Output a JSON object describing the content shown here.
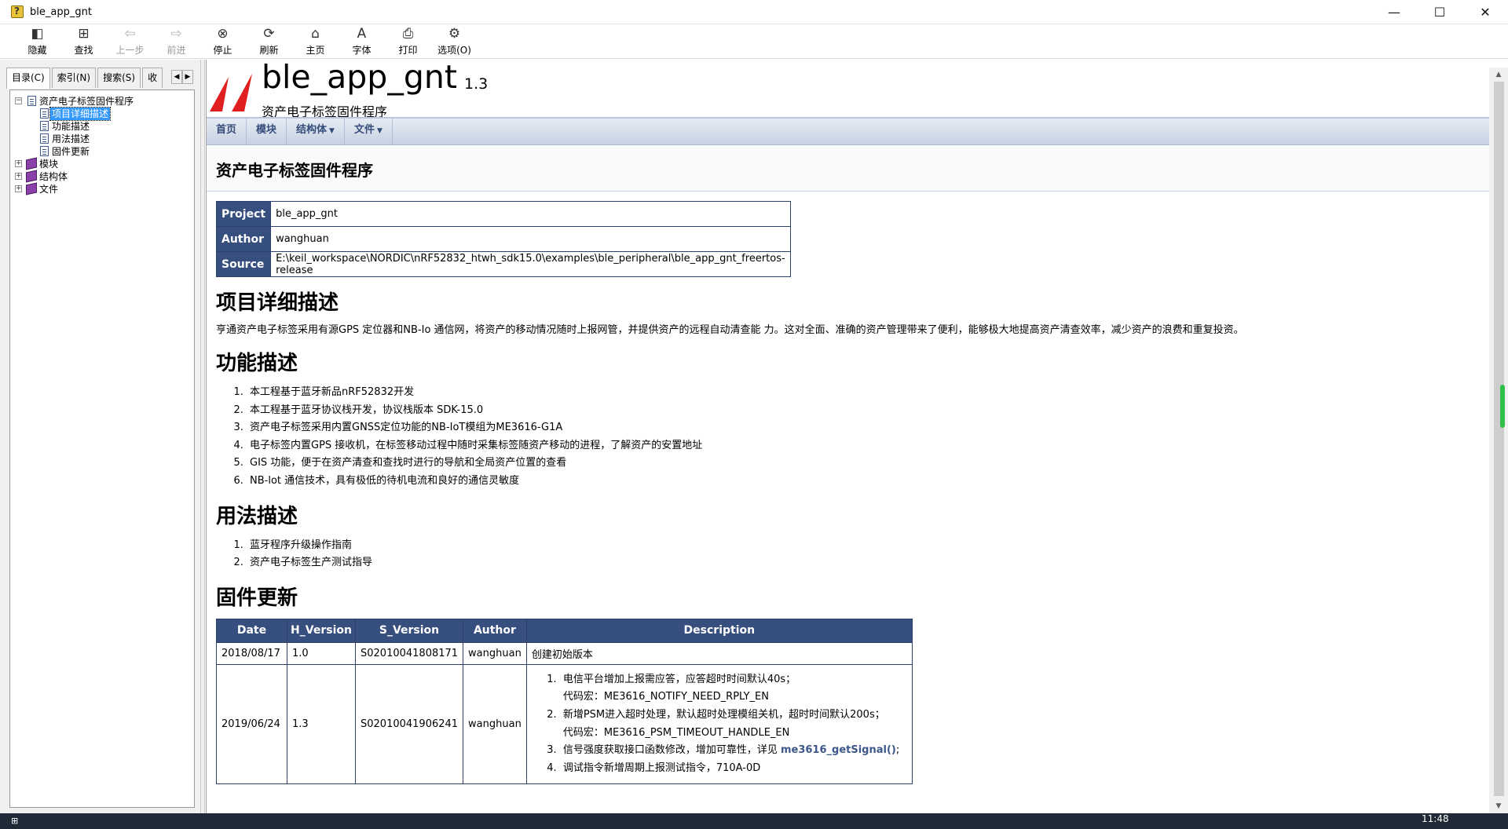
{
  "window": {
    "title": "ble_app_gnt",
    "controls": [
      "—",
      "☐",
      "✕"
    ]
  },
  "toolbar": {
    "buttons": [
      {
        "label": "隐藏",
        "icon": "hide-icon",
        "glyph": "◧",
        "enabled": true
      },
      {
        "label": "查找",
        "icon": "locate-icon",
        "glyph": "⊞",
        "enabled": true
      },
      {
        "label": "上一步",
        "icon": "back-arrow-icon",
        "glyph": "⇦",
        "enabled": false
      },
      {
        "label": "前进",
        "icon": "forward-arrow-icon",
        "glyph": "⇨",
        "enabled": false
      },
      {
        "label": "停止",
        "icon": "stop-icon",
        "glyph": "⊗",
        "enabled": true
      },
      {
        "label": "刷新",
        "icon": "refresh-icon",
        "glyph": "⟳",
        "enabled": true
      },
      {
        "label": "主页",
        "icon": "home-icon",
        "glyph": "⌂",
        "enabled": true
      },
      {
        "label": "字体",
        "icon": "font-icon",
        "glyph": "A",
        "enabled": true
      },
      {
        "label": "打印",
        "icon": "print-icon",
        "glyph": "⎙",
        "enabled": true
      },
      {
        "label": "选项(O)",
        "icon": "options-icon",
        "glyph": "⚙",
        "enabled": true
      }
    ]
  },
  "left_tabs": [
    "目录(C)",
    "索引(N)",
    "搜索(S)",
    "收"
  ],
  "tree": {
    "root": "资产电子标签固件程序",
    "children": [
      "项目详细描述",
      "功能描述",
      "用法描述",
      "固件更新"
    ],
    "books": [
      "模块",
      "结构体",
      "文件"
    ],
    "selected": "项目详细描述"
  },
  "header": {
    "project_name": "ble_app_gnt",
    "project_number": "1.3",
    "project_brief": "资产电子标签固件程序"
  },
  "navbar": [
    {
      "label": "首页",
      "dropdown": false
    },
    {
      "label": "模块",
      "dropdown": false
    },
    {
      "label": "结构体",
      "dropdown": true
    },
    {
      "label": "文件",
      "dropdown": true
    }
  ],
  "page_title": "资产电子标签固件程序",
  "info_table": [
    {
      "key": "Project",
      "value": "ble_app_gnt"
    },
    {
      "key": "Author",
      "value": "wanghuan"
    },
    {
      "key": "Source",
      "value": "E:\\keil_workspace\\NORDIC\\nRF52832_htwh_sdk15.0\\examples\\ble_peripheral\\ble_app_gnt_freertos-release"
    }
  ],
  "sections": {
    "detail_title": "项目详细描述",
    "detail_text": "亨通资产电子标签采用有源GPS 定位器和NB-Io 通信网，将资产的移动情况随时上报网管，并提供资产的远程自动清查能 力。这对全面、准确的资产管理带来了便利，能够极大地提高资产清查效率，减少资产的浪费和重复投资。",
    "function_title": "功能描述",
    "function_items": [
      "本工程基于蓝牙新品nRF52832开发",
      "本工程基于蓝牙协议栈开发，协议栈版本 SDK-15.0",
      "资产电子标签采用内置GNSS定位功能的NB-IoT模组为ME3616-G1A",
      "电子标签内置GPS 接收机，在标签移动过程中随时采集标签随资产移动的进程，了解资产的安置地址",
      "GIS 功能，便于在资产清查和查找时进行的导航和全局资产位置的查看",
      "NB-lot 通信技术，具有极低的待机电流和良好的通信灵敏度"
    ],
    "usage_title": "用法描述",
    "usage_items": [
      "蓝牙程序升级操作指南",
      "资产电子标签生产测试指导"
    ],
    "firmware_title": "固件更新"
  },
  "firmware_table": {
    "headers": [
      "Date",
      "H_Version",
      "S_Version",
      "Author",
      "Description"
    ],
    "row1": {
      "date": "2018/08/17",
      "hver": "1.0",
      "sver": "S02010041808171",
      "author": "wanghuan",
      "desc": "创建初始版本"
    },
    "row2": {
      "date": "2019/06/24",
      "hver": "1.3",
      "sver": "S02010041906241",
      "author": "wanghuan",
      "desc_items": [
        {
          "line": "电信平台增加上报需应答，应答超时时间默认40s；",
          "sub": "代码宏：ME3616_NOTIFY_NEED_RPLY_EN"
        },
        {
          "line": "新增PSM进入超时处理，默认超时处理模组关机，超时时间默认200s；",
          "sub": "代码宏：ME3616_PSM_TIMEOUT_HANDLE_EN"
        },
        {
          "line": "信号强度获取接口函数修改，增加可靠性，详见 ",
          "link": "me3616_getSignal()",
          "tail": ";"
        },
        {
          "line": "调试指令新增周期上报测试指令，710A-0D"
        }
      ]
    }
  },
  "taskbar": {
    "clock": "11:48"
  },
  "colors": {
    "accent": "#374f7f",
    "navbar": "#d4dde9",
    "selection": "#3399ff",
    "logo_red": "#e02020"
  }
}
